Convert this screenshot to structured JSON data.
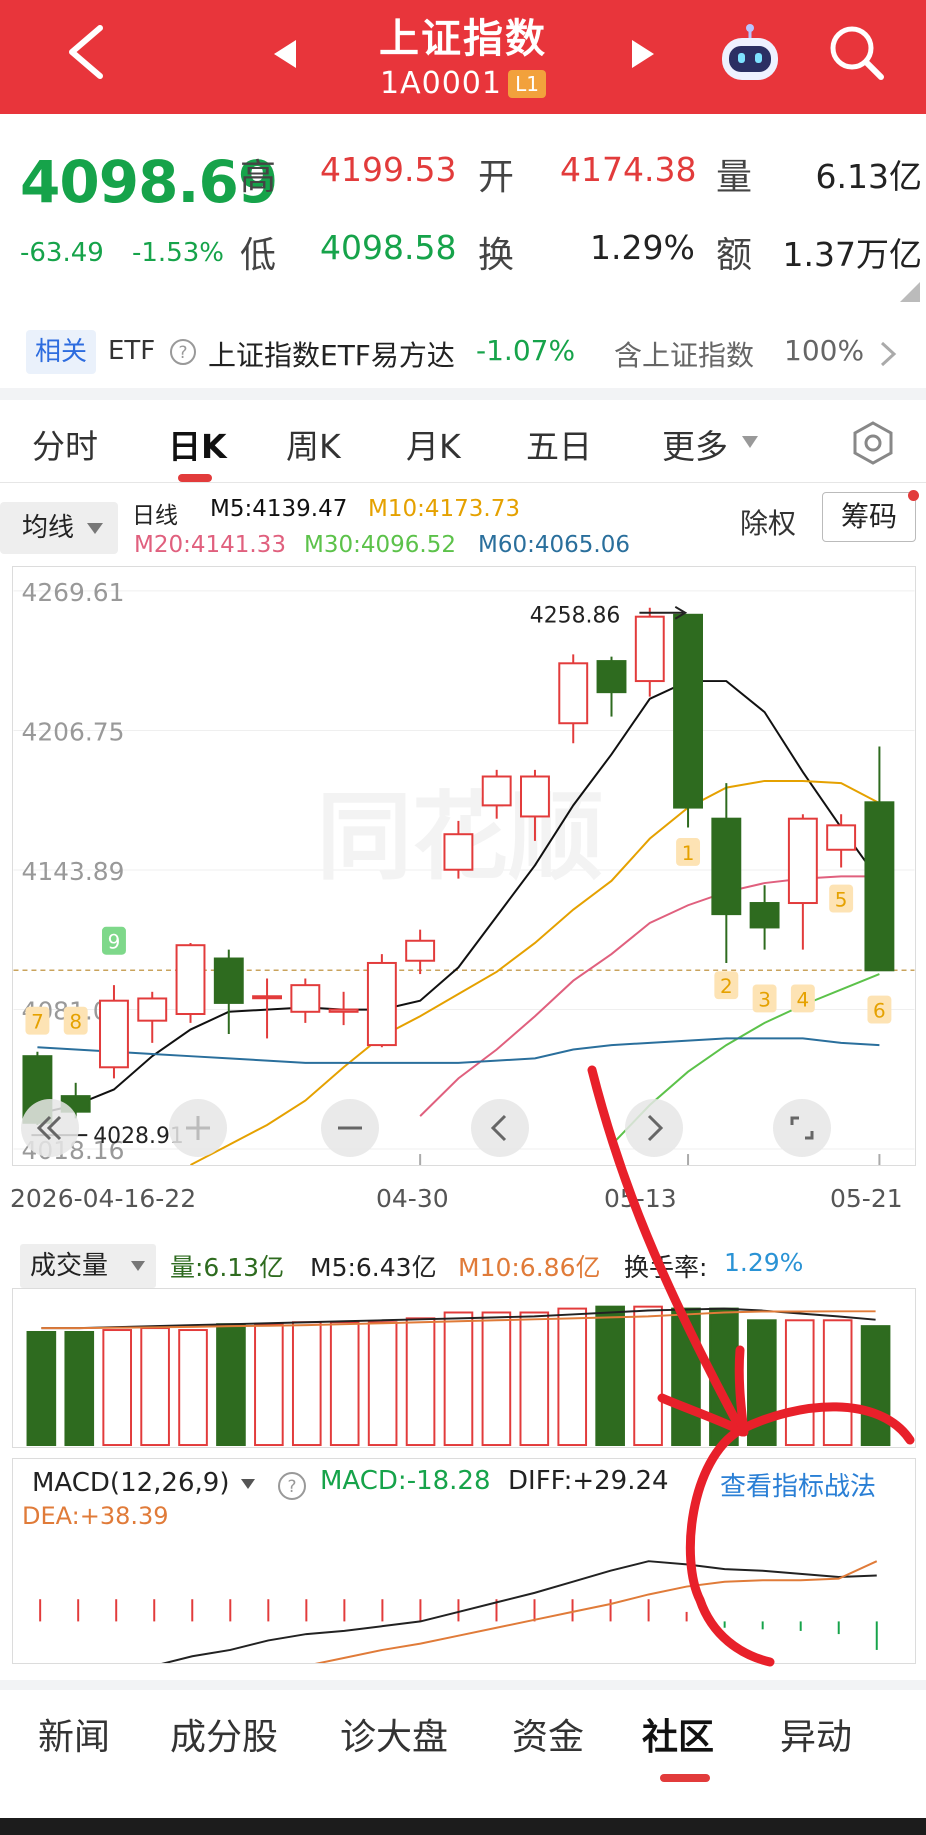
{
  "header": {
    "title": "上证指数",
    "code": "1A0001",
    "level": "L1"
  },
  "quote": {
    "price": "4098.69",
    "change": "-63.49",
    "change_pct": "-1.53%",
    "high_label": "高",
    "high": "4199.53",
    "open_label": "开",
    "open": "4174.38",
    "volume_label": "量",
    "volume": "6.13亿",
    "low_label": "低",
    "low": "4098.58",
    "turnover_label": "换",
    "turnover": "1.29%",
    "amount_label": "额",
    "amount": "1.37万亿"
  },
  "related": {
    "tag": "相关",
    "etf_label": "ETF",
    "etf_name": "上证指数ETF易方达",
    "etf_change": "-1.07%",
    "holding_label": "含上证指数",
    "holding_pct": "100%"
  },
  "period_tabs": [
    "分时",
    "日K",
    "周K",
    "月K",
    "五日",
    "更多"
  ],
  "indicators": {
    "ma_button": "均线",
    "line_label": "日线",
    "m5": "M5:4139.47",
    "m10": "M10:4173.73",
    "m20": "M20:4141.33",
    "m30": "M30:4096.52",
    "m60": "M60:4065.06",
    "exright": "除权",
    "chips": "筹码"
  },
  "colors": {
    "up": "#e23b3b",
    "down": "#2e6b1f",
    "m5": "#111111",
    "m10": "#e5a100",
    "m20": "#e0607e",
    "m30": "#5cc24a",
    "m60": "#2a6f9c",
    "brand": "#e8353b"
  },
  "kline": {
    "y_ticks": [
      "4269.61",
      "4206.75",
      "4143.89",
      "4081.02",
      "4018.16"
    ],
    "x_ticks": [
      "2026-04-16-22",
      "04-30",
      "05-13",
      "05-21"
    ],
    "max_label": "4258.86",
    "min_label": "4028.91",
    "marker_labels": [
      "7",
      "8",
      "9",
      "1",
      "2",
      "3",
      "4",
      "5",
      "6"
    ]
  },
  "chart_data": {
    "type": "candlestick",
    "ylim": [
      4018.16,
      4269.61
    ],
    "candles": [
      {
        "o": 4060,
        "c": 4030,
        "h": 4062,
        "l": 4029
      },
      {
        "o": 4042,
        "c": 4035,
        "h": 4048,
        "l": 4032
      },
      {
        "o": 4055,
        "c": 4085,
        "h": 4092,
        "l": 4050
      },
      {
        "o": 4076,
        "c": 4086,
        "h": 4089,
        "l": 4066
      },
      {
        "o": 4079,
        "c": 4110,
        "h": 4111,
        "l": 4075
      },
      {
        "o": 4104,
        "c": 4084,
        "h": 4108,
        "l": 4070
      },
      {
        "o": 4087,
        "c": 4087,
        "h": 4095,
        "l": 4068
      },
      {
        "o": 4080,
        "c": 4092,
        "h": 4095,
        "l": 4075
      },
      {
        "o": 4080,
        "c": 4081,
        "h": 4089,
        "l": 4074
      },
      {
        "o": 4065,
        "c": 4102,
        "h": 4106,
        "l": 4064
      },
      {
        "o": 4103,
        "c": 4112,
        "h": 4117,
        "l": 4097
      },
      {
        "o": 4144,
        "c": 4160,
        "h": 4166,
        "l": 4140
      },
      {
        "o": 4173,
        "c": 4186,
        "h": 4189,
        "l": 4167
      },
      {
        "o": 4168,
        "c": 4186,
        "h": 4189,
        "l": 4157
      },
      {
        "o": 4210,
        "c": 4237,
        "h": 4241,
        "l": 4201
      },
      {
        "o": 4238,
        "c": 4224,
        "h": 4240,
        "l": 4213
      },
      {
        "o": 4229,
        "c": 4258,
        "h": 4262,
        "l": 4222
      },
      {
        "o": 4258.86,
        "c": 4172,
        "h": 4258.86,
        "l": 4163
      },
      {
        "o": 4167,
        "c": 4124,
        "h": 4183,
        "l": 4102
      },
      {
        "o": 4129,
        "c": 4118,
        "h": 4137,
        "l": 4108
      },
      {
        "o": 4129,
        "c": 4167,
        "h": 4169,
        "l": 4108
      },
      {
        "o": 4153,
        "c": 4164,
        "h": 4169,
        "l": 4145
      },
      {
        "o": 4174.38,
        "c": 4098.69,
        "h": 4199.53,
        "l": 4098.58
      }
    ],
    "ma": {
      "m5": [
        4034,
        4038,
        4045,
        4060,
        4072,
        4080,
        4081,
        4082,
        4081,
        4081,
        4085,
        4100,
        4123,
        4146,
        4173,
        4196,
        4221,
        4229,
        4229,
        4215,
        4188,
        4163,
        4139
      ],
      "m10": [
        null,
        null,
        null,
        null,
        4011,
        4020,
        4029,
        4040,
        4055,
        4069,
        4078,
        4088,
        4098,
        4111,
        4126,
        4139,
        4158,
        4172,
        4181,
        4184,
        4184,
        4183,
        4174
      ],
      "m20": [
        null,
        null,
        null,
        null,
        null,
        null,
        null,
        null,
        null,
        null,
        4033,
        4050,
        4063,
        4078,
        4094,
        4106,
        4120,
        4128,
        4134,
        4138,
        4140,
        4141,
        4141
      ],
      "m30": [
        null,
        null,
        null,
        null,
        null,
        null,
        null,
        null,
        null,
        null,
        null,
        null,
        null,
        null,
        null,
        4020,
        4038,
        4053,
        4065,
        4075,
        4083,
        4090,
        4097
      ],
      "m60": [
        4064,
        4063,
        4062,
        4061,
        4060,
        4059,
        4058,
        4057,
        4057,
        4057,
        4057,
        4057,
        4058,
        4059,
        4063,
        4065,
        4066,
        4067,
        4068,
        4068,
        4068,
        4066,
        4065
      ]
    },
    "volume": {
      "label": "成交量",
      "current": "量:6.13亿",
      "m5": "M5:6.43亿",
      "m10": "M10:6.86亿",
      "turnover_label": "换手率:",
      "turnover": "1.29%",
      "values": [
        5.8,
        5.8,
        5.9,
        6.0,
        5.9,
        6.2,
        6.2,
        6.3,
        6.3,
        6.3,
        6.5,
        6.8,
        6.8,
        6.8,
        7.0,
        7.1,
        7.1,
        7.0,
        7.0,
        6.4,
        6.4,
        6.4,
        6.1
      ],
      "m5_line": [
        6.0,
        6.0,
        6.05,
        6.1,
        6.15,
        6.2,
        6.25,
        6.3,
        6.35,
        6.4,
        6.45,
        6.5,
        6.55,
        6.6,
        6.7,
        6.8,
        6.9,
        6.95,
        7.0,
        6.9,
        6.75,
        6.6,
        6.43
      ],
      "m10_line": [
        6.0,
        6.0,
        6.02,
        6.04,
        6.06,
        6.1,
        6.12,
        6.15,
        6.2,
        6.25,
        6.3,
        6.35,
        6.4,
        6.45,
        6.5,
        6.55,
        6.6,
        6.7,
        6.8,
        6.85,
        6.85,
        6.86,
        6.86
      ]
    },
    "macd": {
      "label": "MACD(12,26,9)",
      "macd_value": "MACD:-18.28",
      "diff_value": "DIFF:+29.24",
      "dea_value": "DEA:+38.39",
      "link": "查看指标战法",
      "hist": [
        14,
        14,
        14,
        14,
        14,
        14,
        14,
        14,
        14,
        14,
        14,
        14,
        14,
        14,
        14,
        14,
        14,
        6,
        -4,
        -5,
        -6,
        -8,
        -18
      ],
      "diff": [
        -45,
        -40,
        -35,
        -28,
        -22,
        -18,
        -12,
        -8,
        -6,
        -3,
        0,
        6,
        12,
        18,
        25,
        32,
        38,
        36,
        33,
        32,
        30,
        28,
        29
      ],
      "dea": [
        -70,
        -64,
        -58,
        -50,
        -44,
        -38,
        -33,
        -28,
        -23,
        -18,
        -14,
        -9,
        -4,
        1,
        6,
        11,
        17,
        22,
        25,
        26,
        26,
        27,
        38
      ]
    }
  },
  "bottom_tabs": [
    "新闻",
    "成分股",
    "诊大盘",
    "资金",
    "社区",
    "异动"
  ]
}
